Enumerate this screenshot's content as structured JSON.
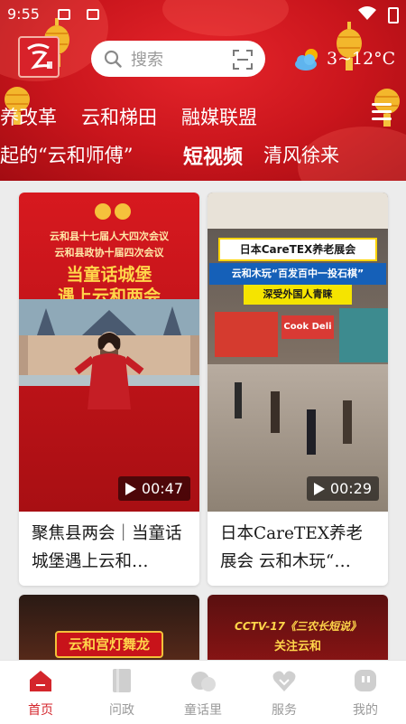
{
  "status_bar": {
    "time": "9:55"
  },
  "search": {
    "placeholder": "搜索"
  },
  "weather": {
    "temperature": "3~12°C",
    "icon": "cloud-sun-icon"
  },
  "channels_row1": [
    "养改革",
    "云和梯田",
    "融媒联盟"
  ],
  "channels_row2": [
    "起的“云和师傅”",
    "短视频",
    "清风徐来"
  ],
  "active_channel": "短视频",
  "videos": [
    {
      "thumb_line1": "云和县十七届人大四次会议",
      "thumb_line2": "云和县政协十届四次会议",
      "thumb_headline1": "当童话城堡",
      "thumb_headline2": "遇上云和两会",
      "duration": "00:47",
      "title": "聚焦县两会｜当童话城堡遇上云和…"
    },
    {
      "thumb_line1": "日本CareTEX养老展会",
      "thumb_line2": "云和木玩“百发百中一投石棋”",
      "thumb_line3": "深受外国人青睐",
      "booth_sign": "Cook Deli",
      "duration": "00:29",
      "title": "日本CareTEX养老展会 云和木玩“…"
    },
    {
      "thumb_headline": "云和宫灯舞龙"
    },
    {
      "thumb_headline1": "CCTV-17《三农长短说》",
      "thumb_headline2": "关注云和"
    }
  ],
  "tabbar": [
    {
      "label": "首页",
      "icon": "home-icon",
      "active": true
    },
    {
      "label": "问政",
      "icon": "document-icon",
      "active": false
    },
    {
      "label": "童话里",
      "icon": "bubble-icon",
      "active": false
    },
    {
      "label": "服务",
      "icon": "heart-icon",
      "active": false
    },
    {
      "label": "我的",
      "icon": "user-icon",
      "active": false
    }
  ],
  "colors": {
    "brand_red": "#d4262c",
    "header_red": "#c9151c",
    "inactive_gray": "#9a9a9a"
  }
}
